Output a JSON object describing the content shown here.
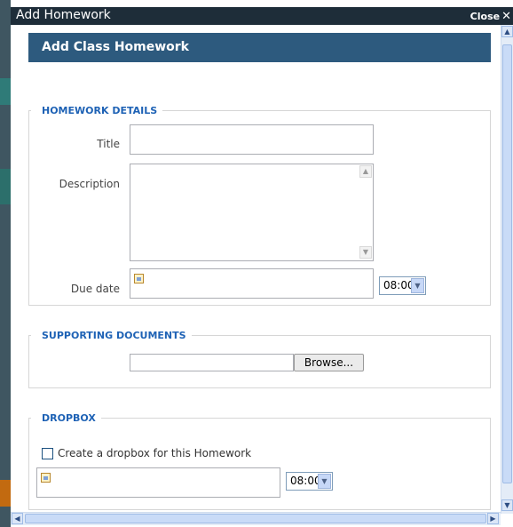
{
  "window": {
    "title": "Add Homework",
    "close_label": "Close",
    "close_glyph": "✕"
  },
  "header": {
    "title": "Add Class Homework"
  },
  "homework_details": {
    "legend": "HOMEWORK DETAILS",
    "title_label": "Title",
    "title_value": "",
    "description_label": "Description",
    "description_value": "",
    "due_date_label": "Due date",
    "due_date_value": "",
    "due_time": "08:00"
  },
  "supporting_documents": {
    "legend": "SUPPORTING DOCUMENTS",
    "file_value": "",
    "browse_label": "Browse..."
  },
  "dropbox": {
    "legend": "DROPBOX",
    "checkbox_label": "Create a dropbox for this Homework",
    "checked": false,
    "date_value": "",
    "time": "08:00"
  },
  "icons": {
    "calendar": "calendar-icon",
    "dropdown": "chevron-down-icon",
    "scroll_up": "scroll-up-arrow-icon",
    "scroll_down": "scroll-down-arrow-icon"
  },
  "colors": {
    "titlebar": "#1e2d39",
    "header": "#2d5a7e",
    "legend": "#1e62b5"
  }
}
